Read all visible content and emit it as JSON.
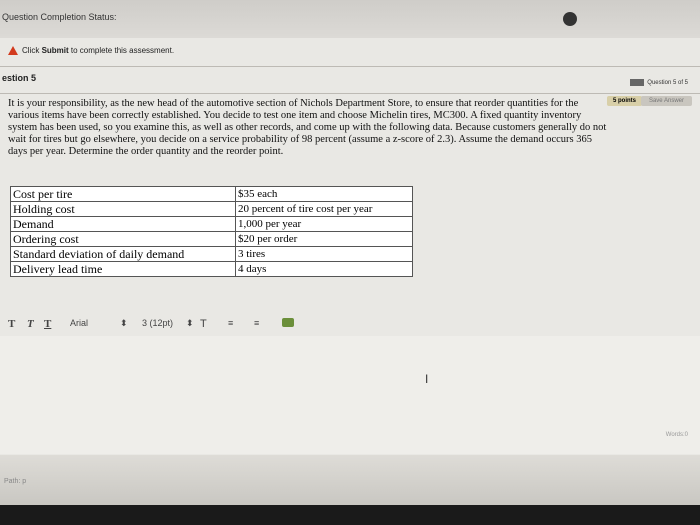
{
  "header": {
    "status_label": "Question Completion Status:"
  },
  "notice": {
    "text_pre": "Click ",
    "text_bold": "Submit",
    "text_post": " to complete this assessment."
  },
  "question": {
    "title": "estion 5",
    "nav_label": "Question 5 of 5",
    "points": "5 points",
    "save_label": "Save Answer",
    "prompt": "It is your responsibility, as the new head of the automotive section of Nichols Department Store, to ensure that reorder quantities for the various items have been correctly established. You decide to test one item and choose Michelin tires, MC300. A fixed quantity inventory system has been used, so you examine this, as well as other records, and come up with the following data. Because customers generally do not wait for tires but go elsewhere, you decide on a service probability of 98 percent (assume a z-score of 2.3). Assume the demand occurs 365 days per year. Determine the order quantity and the reorder point."
  },
  "table": {
    "rows": [
      {
        "label": "Cost per tire",
        "value": "$35 each"
      },
      {
        "label": "Holding cost",
        "value": "20 percent of tire cost per year"
      },
      {
        "label": "Demand",
        "value": "1,000 per year"
      },
      {
        "label": "Ordering cost",
        "value": "$20 per order"
      },
      {
        "label": "Standard deviation of daily demand",
        "value": "3 tires"
      },
      {
        "label": "Delivery lead time",
        "value": "4 days"
      }
    ]
  },
  "toolbar": {
    "t1": "T",
    "t2": "T",
    "t3": "T",
    "font": "Arial",
    "size": "3 (12pt)",
    "text_color": "T",
    "list1": "≡",
    "list2": "≡"
  },
  "editor": {
    "cursor": "I",
    "words_label": "Words:0",
    "path_label": "Path: p"
  },
  "icons": {
    "warning": "warning-icon",
    "globe": "globe-icon"
  },
  "colors": {
    "warning": "#d23a1d",
    "points_badge": "#d8cfa8"
  }
}
